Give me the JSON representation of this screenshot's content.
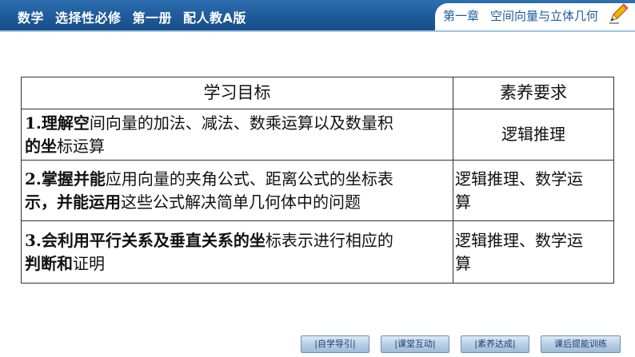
{
  "header": {
    "left_items": [
      "数学",
      "选择性必修",
      "第一册",
      "配人教A版"
    ],
    "right_items": [
      "第一章",
      "空间向量与立体几何"
    ],
    "pencil_icon": "pencil-icon",
    "bar_color": "#1f5a99"
  },
  "table": {
    "headers": [
      "学习目标",
      "素养要求"
    ],
    "rows": [
      {
        "goal_line1_bold": "1.理解空",
        "goal_line1_rest": "间向量的加法、减法、数乘运算以及数量积",
        "goal_line2_bold": "的坐",
        "goal_line2_rest": "标运算",
        "req_line1": "逻辑推理",
        "req_line2": ""
      },
      {
        "goal_line1_bold": "2.掌握并能",
        "goal_line1_rest": "应用向量的夹角公式、距离公式的坐标表",
        "goal_line2_bold": "示，并能运用",
        "goal_line2_rest": "这些公式解决简单几何体中的问题",
        "req_line1": "逻辑推理、数学运",
        "req_line2": "算"
      },
      {
        "goal_line1_bold": "3.会利用平行关系及垂直关系的坐",
        "goal_line1_rest": "标表示进行相应的",
        "goal_line2_bold": "判断和",
        "goal_line2_rest": "证明",
        "req_line1": "逻辑推理、数学运",
        "req_line2": "算"
      }
    ]
  },
  "nav": {
    "items": [
      "|自学导引|",
      "|课堂互动|",
      "|素养达成|",
      "课后提能训练"
    ]
  }
}
